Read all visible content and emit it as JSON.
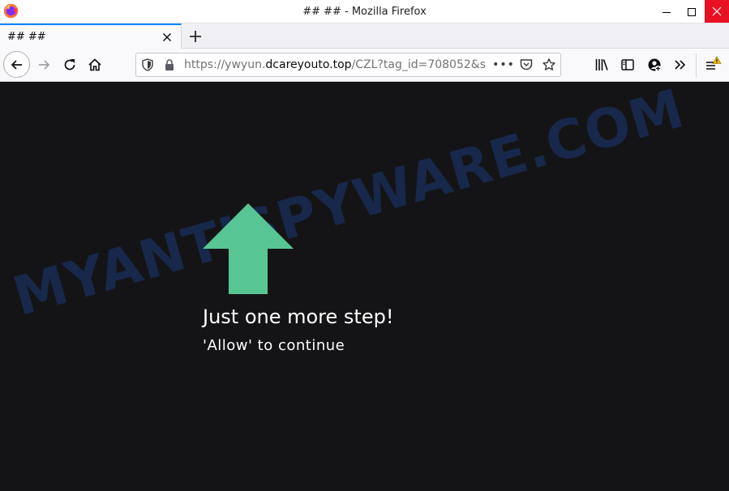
{
  "window": {
    "title": "## ## - Mozilla Firefox"
  },
  "tabs": [
    {
      "title": "## ##"
    }
  ],
  "urlbar": {
    "url_prefix": "https://ywyun.",
    "url_domain": "dcareyouto.top",
    "url_suffix": "/CZL?tag_id=708052&s",
    "page_actions": "•••"
  },
  "content": {
    "headline": "Just one more step!",
    "subline": "'Allow' to continue",
    "arrow_color": "#57c694",
    "background": "#141416"
  },
  "watermark": {
    "text": "MYANTISPYWARE.COM"
  },
  "colors": {
    "close_button": "#e81123",
    "tab_accent": "#0a84ff",
    "menu_warning": "#ffbf00"
  },
  "icons": [
    "firefox-logo-icon",
    "minimize-icon",
    "maximize-icon",
    "close-icon",
    "tab-close-icon",
    "new-tab-icon",
    "back-icon",
    "forward-icon",
    "reload-icon",
    "home-icon",
    "shield-icon",
    "lock-icon",
    "pocket-icon",
    "star-icon",
    "library-icon",
    "sidebar-icon",
    "account-icon",
    "overflow-icon",
    "menu-icon"
  ]
}
